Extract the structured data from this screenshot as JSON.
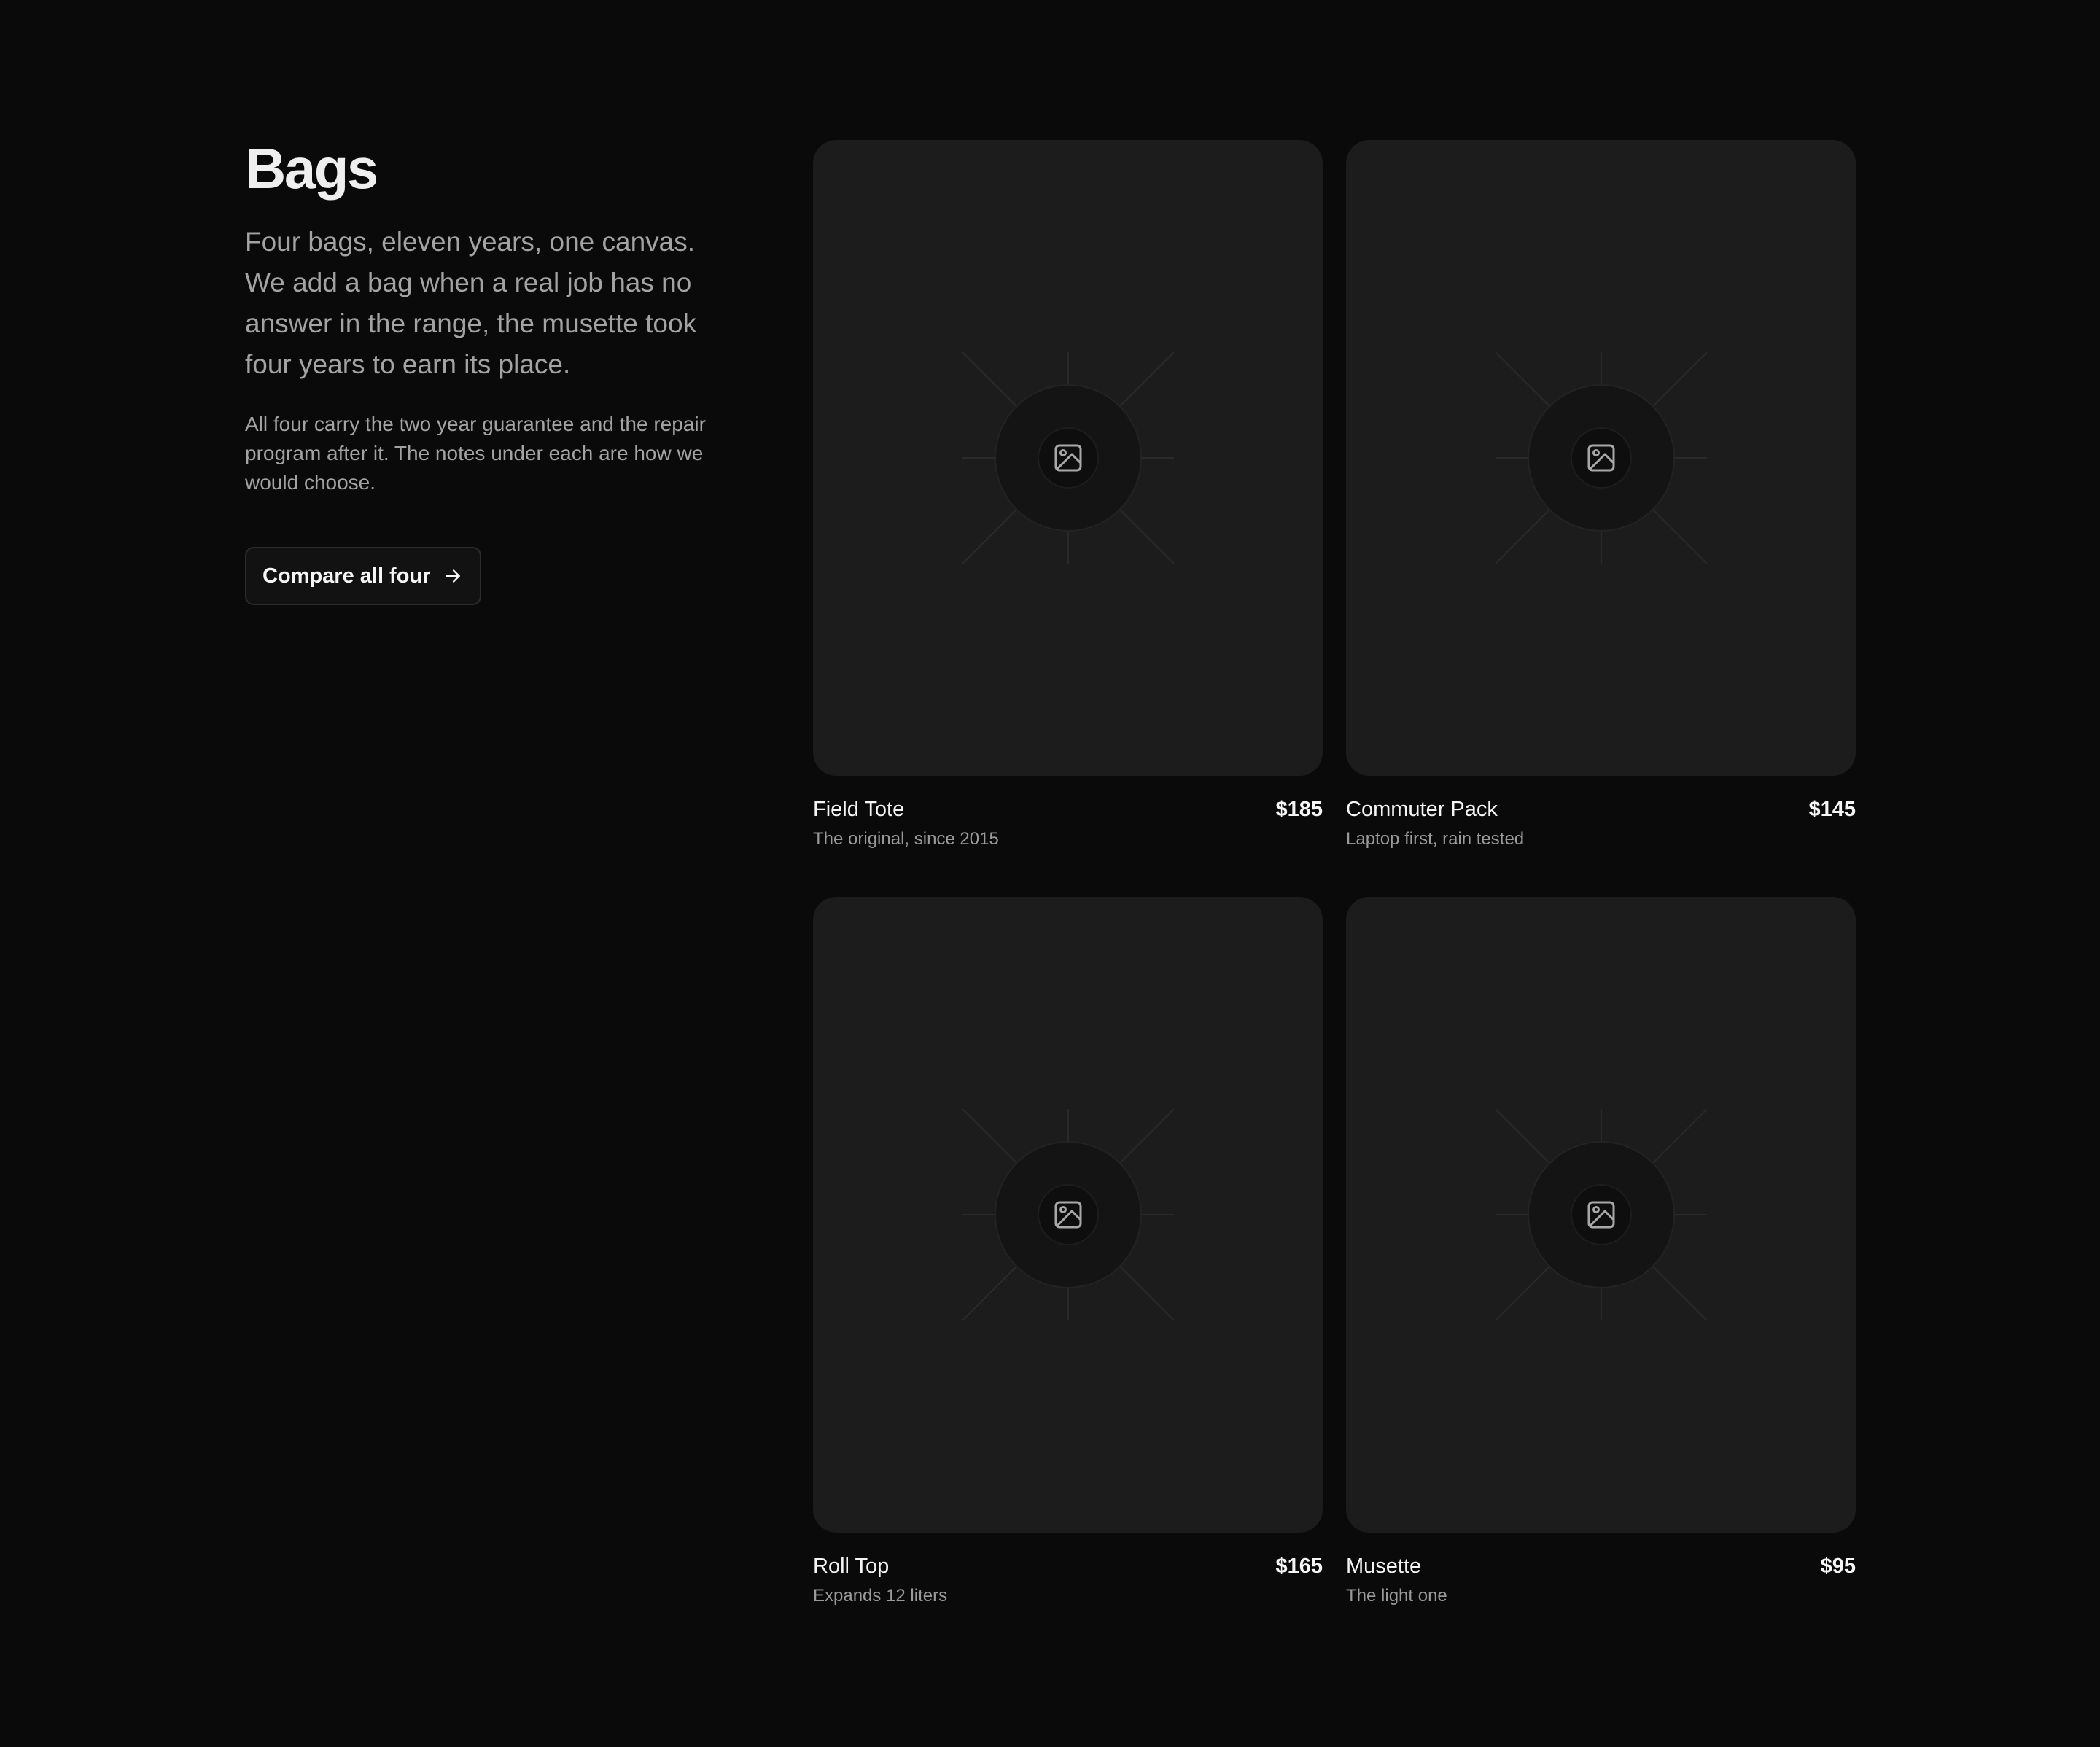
{
  "intro": {
    "title": "Bags",
    "lead": "Four bags, eleven years, one canvas. We add a bag when a real job has no answer in the range, the musette took four years to earn its place.",
    "sub": "All four carry the two year guarantee and the repair program after it. The notes under each are how we would choose.",
    "cta_label": "Compare all four",
    "cta_icon": "arrow-right-icon"
  },
  "products": [
    {
      "name": "Field Tote",
      "price": "$185",
      "note": "The original, since 2015",
      "image_icon": "image-placeholder-icon"
    },
    {
      "name": "Commuter Pack",
      "price": "$145",
      "note": "Laptop first, rain tested",
      "image_icon": "image-placeholder-icon"
    },
    {
      "name": "Roll Top",
      "price": "$165",
      "note": "Expands 12 liters",
      "image_icon": "image-placeholder-icon"
    },
    {
      "name": "Musette",
      "price": "$95",
      "note": "The light one",
      "image_icon": "image-placeholder-icon"
    }
  ],
  "colors": {
    "background": "#0a0a0a",
    "card": "#1c1c1c",
    "text": "#f5f5f5",
    "muted": "#a3a3a3"
  }
}
